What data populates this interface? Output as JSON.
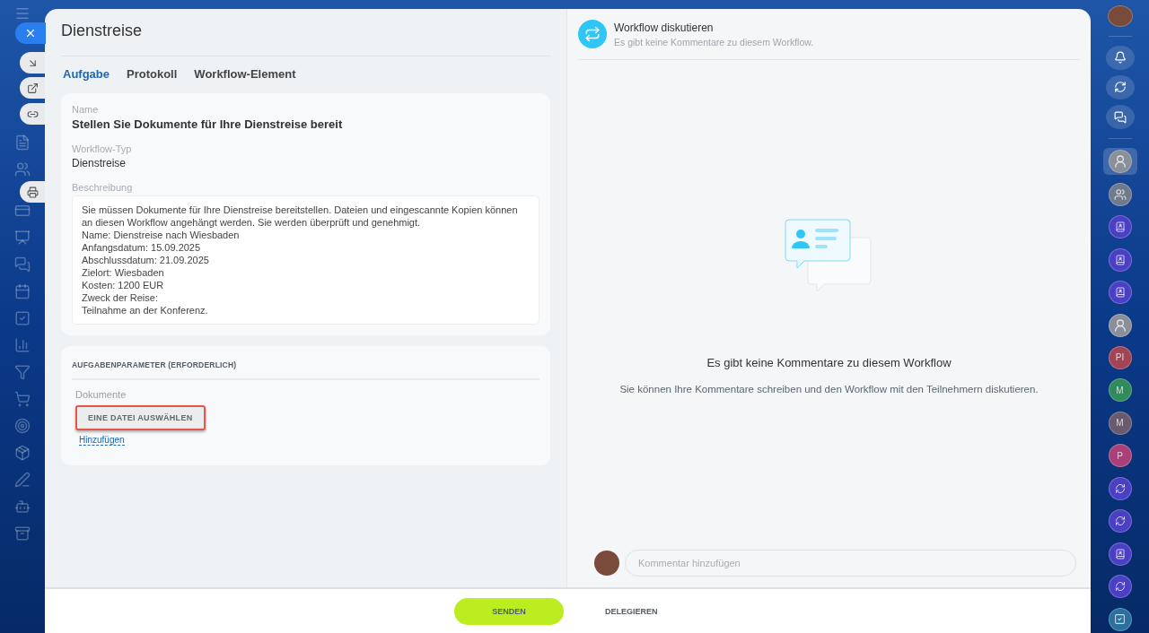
{
  "title": "Dienstreise",
  "tabs": [
    {
      "label": "Aufgabe",
      "selected": true
    },
    {
      "label": "Protokoll",
      "selected": false
    },
    {
      "label": "Workflow-Element",
      "selected": false
    }
  ],
  "details": [
    {
      "label": "Name",
      "value": "Stellen Sie Dokumente für Ihre Dienstreise bereit",
      "kind": "heading"
    },
    {
      "label": "Workflow-Typ",
      "value": "Dienstreise",
      "kind": "plain"
    }
  ],
  "description": {
    "label": "Beschreibung",
    "text": "Sie müssen Dokumente für Ihre Dienstreise bereitstellen. Dateien und eingescannte Kopien können an diesen Workflow angehängt werden. Sie werden überprüft und genehmigt.\nName: Dienstreise nach Wiesbaden\nAnfangsdatum: 15.09.2025\nAbschlussdatum: 21.09.2025\nZielort: Wiesbaden\nKosten: 1200 EUR\nZweck der Reise:\nTeilnahme an der Konferenz."
  },
  "parameters": {
    "heading": "AUFGABENPARAMETER (ERFORDERLICH)",
    "field_label": "Dokumente",
    "file_button": "EINE DATEI AUSWÄHLEN",
    "highlighted": true,
    "add_link": "Hinzufügen"
  },
  "discussion": {
    "title": "Workflow diskutieren",
    "subtitle": "Es gibt keine Kommentare zu diesem Workflow.",
    "empty_title": "Es gibt keine Kommentare zu diesem Workflow",
    "empty_text": "Sie können Ihre Kommentare schreiben und den Workflow mit den Teilnehmern diskutieren.",
    "comment_placeholder": "Kommentar hinzufügen"
  },
  "footer": {
    "primary": "SENDEN",
    "secondary": "DELEGIEREN"
  },
  "chats": [
    {
      "kind": "photo",
      "selected": true
    },
    {
      "kind": "group",
      "selected": false
    },
    {
      "kind": "bot",
      "selected": false
    },
    {
      "kind": "bot",
      "selected": false
    },
    {
      "kind": "bot",
      "selected": false
    },
    {
      "kind": "photo",
      "selected": false
    },
    {
      "kind": "letter",
      "text": "PI",
      "color": "#a34455",
      "selected": false
    },
    {
      "kind": "letter",
      "text": "M",
      "color": "#2f8a5c",
      "selected": false
    },
    {
      "kind": "letter",
      "text": "M",
      "color": "#6a5a6e",
      "selected": false
    },
    {
      "kind": "letter",
      "text": "P",
      "color": "#a8407a",
      "selected": false
    },
    {
      "kind": "workflow",
      "selected": false
    },
    {
      "kind": "workflow",
      "selected": false
    },
    {
      "kind": "bot",
      "selected": false
    },
    {
      "kind": "workflow",
      "selected": false
    },
    {
      "kind": "tasks",
      "selected": false
    }
  ]
}
